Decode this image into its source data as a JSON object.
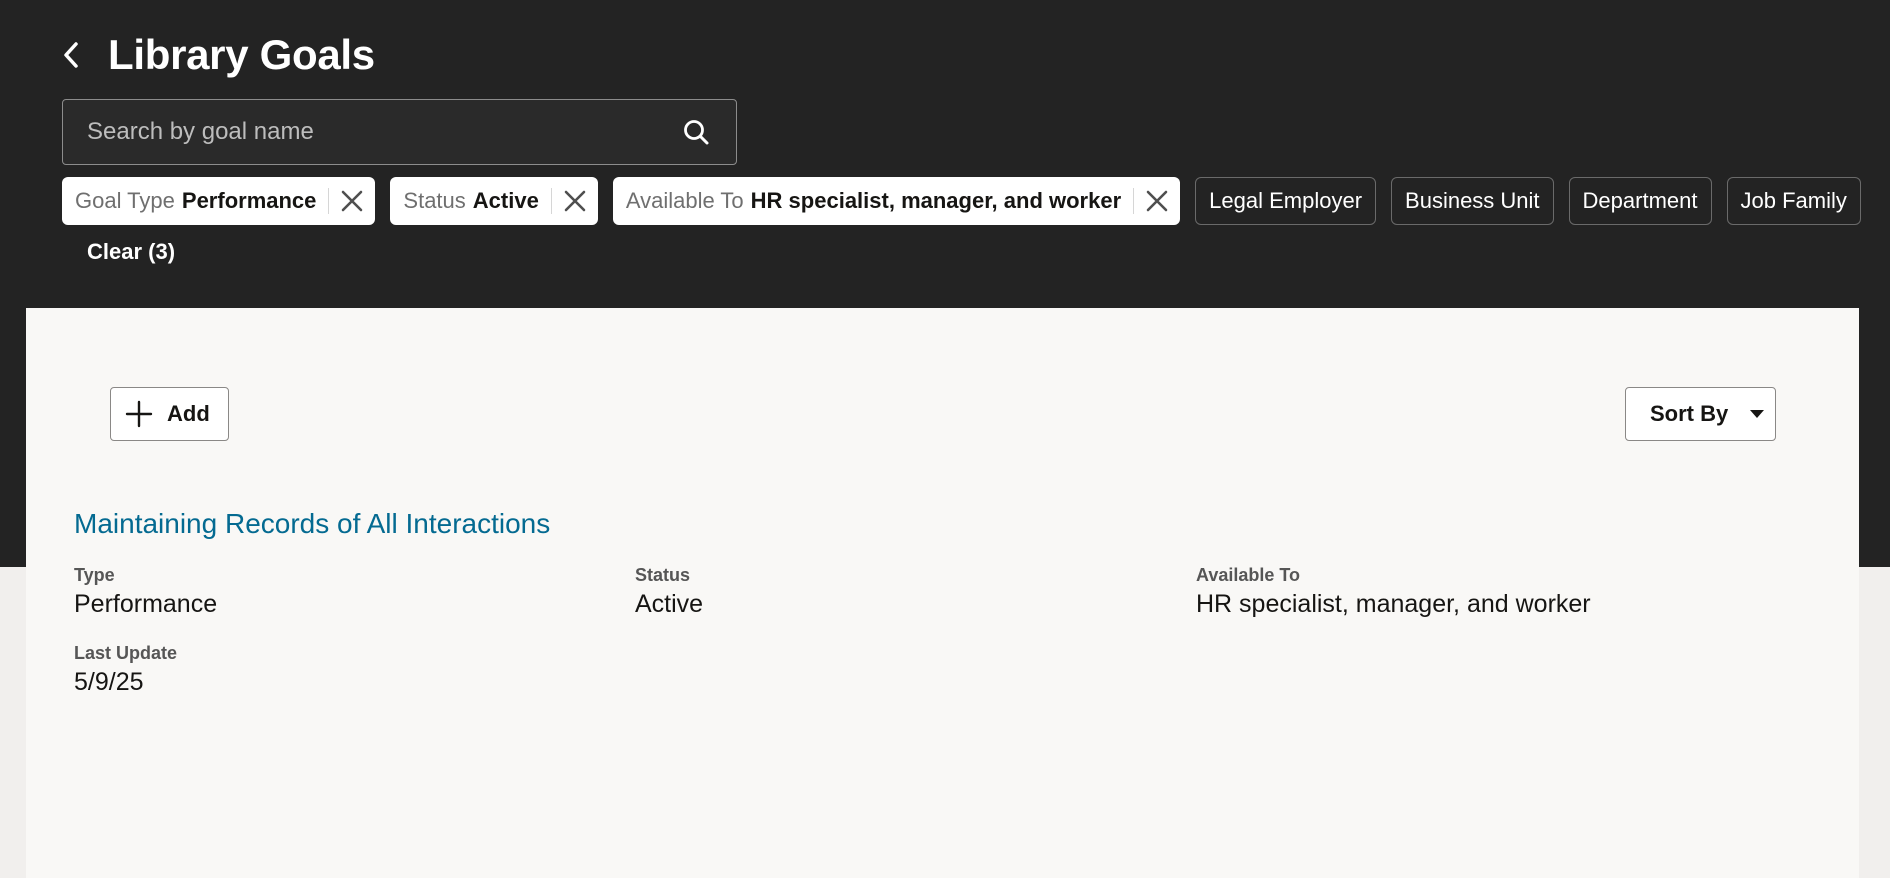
{
  "header": {
    "title": "Library Goals"
  },
  "search": {
    "placeholder": "Search by goal name"
  },
  "filters": {
    "selected": [
      {
        "key": "Goal Type",
        "value": "Performance"
      },
      {
        "key": "Status",
        "value": "Active"
      },
      {
        "key": "Available To",
        "value": "HR specialist, manager, and worker"
      }
    ],
    "unselected": [
      "Legal Employer",
      "Business Unit",
      "Department",
      "Job Family"
    ],
    "clear_label": "Clear (3)"
  },
  "toolbar": {
    "add_label": "Add",
    "sort_label": "Sort By"
  },
  "goals": [
    {
      "title": "Maintaining Records of All Interactions",
      "type_label": "Type",
      "type": "Performance",
      "status_label": "Status",
      "status": "Active",
      "available_label": "Available To",
      "available": "HR specialist, manager, and worker",
      "updated_label": "Last Update",
      "updated": "5/9/25"
    }
  ],
  "colors": {
    "header_bg": "#232323",
    "link": "#046a91",
    "panel_bg": "#f9f8f6"
  },
  "icons": {
    "back": "chevron-left-icon",
    "search": "search-icon",
    "chip_remove": "close-icon",
    "add": "plus-icon",
    "sort": "caret-down-icon"
  }
}
